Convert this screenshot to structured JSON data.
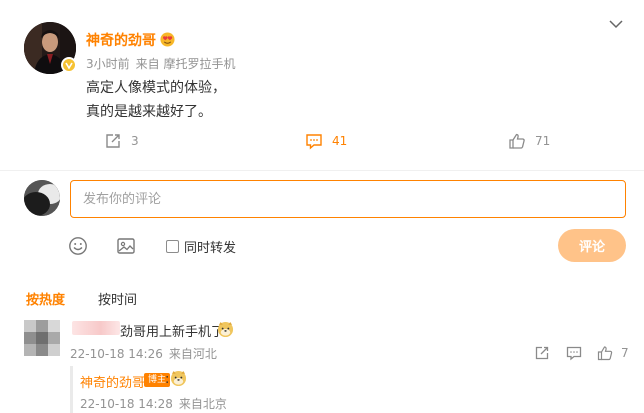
{
  "post": {
    "user_name": "神奇的劲哥",
    "name_emoji_icon": "heart-eyes-emoji-icon",
    "verified_icon": "verified-v-badge-icon",
    "time": "3小时前",
    "source": "来自 摩托罗拉手机",
    "text_lines": [
      "高定人像模式的体验，",
      "真的是越来越好了。"
    ],
    "actions": {
      "repost_count": "3",
      "comment_count": "41",
      "like_count": "71"
    }
  },
  "composer": {
    "placeholder": "发布你的评论",
    "repost_label": "同时转发",
    "repost_checked": false,
    "submit_label": "评论"
  },
  "sort": {
    "hot_label": "按热度",
    "time_label": "按时间",
    "active": "hot"
  },
  "comments": [
    {
      "text": "劲哥用上新手机了",
      "emoji_icon": "doge-emoji-icon",
      "date": "22-10-18 14:26",
      "location": "来自河北",
      "like_count": "7",
      "reply": {
        "name": "神奇的劲哥",
        "badge": "博主",
        "colon": ":",
        "emoji_icon": "doge-emoji-icon",
        "date": "22-10-18 14:28",
        "location": "来自北京"
      }
    }
  ],
  "colors": {
    "accent": "#ff8200",
    "submit_disabled": "#ffc389",
    "muted_text": "#939393"
  }
}
